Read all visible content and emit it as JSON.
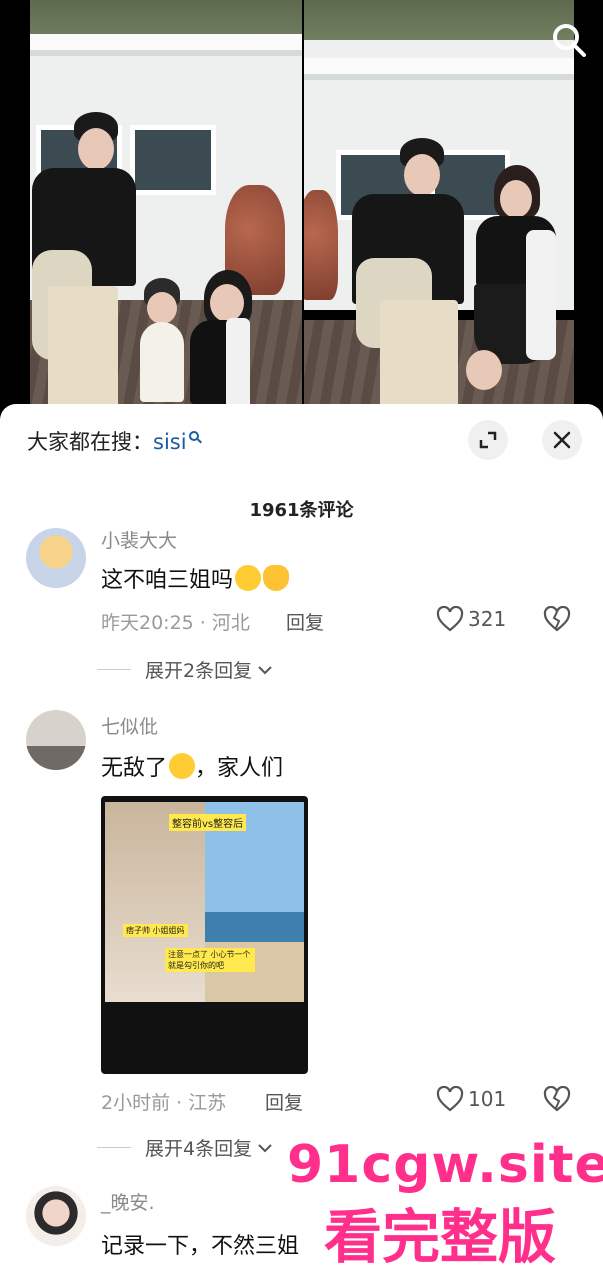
{
  "search": {
    "prefix": "大家都在搜：",
    "keyword": "sisi"
  },
  "comments_count": "1961条评论",
  "comments": [
    {
      "user": "小裴大大",
      "text": "这不咱三姐吗",
      "meta": "昨天20:25 · 河北",
      "reply": "回复",
      "likes": "321",
      "expand": "展开2条回复"
    },
    {
      "user": "七似仳",
      "text_a": "无敌了",
      "text_b": "，家人们",
      "meta": "2小时前 · 江苏",
      "reply": "回复",
      "likes": "101",
      "expand": "展开4条回复",
      "thumb_tags": {
        "top": "整容前vs整容后",
        "left": "痞子帅 小姐姐妈",
        "right": "注意一点了 小心节一个就是勾引你的吧"
      }
    },
    {
      "user": "_晚安.",
      "text": "记录一下，不然三姐"
    }
  ],
  "watermark": {
    "line1": "91cgw.site",
    "line2": "看完整版"
  }
}
